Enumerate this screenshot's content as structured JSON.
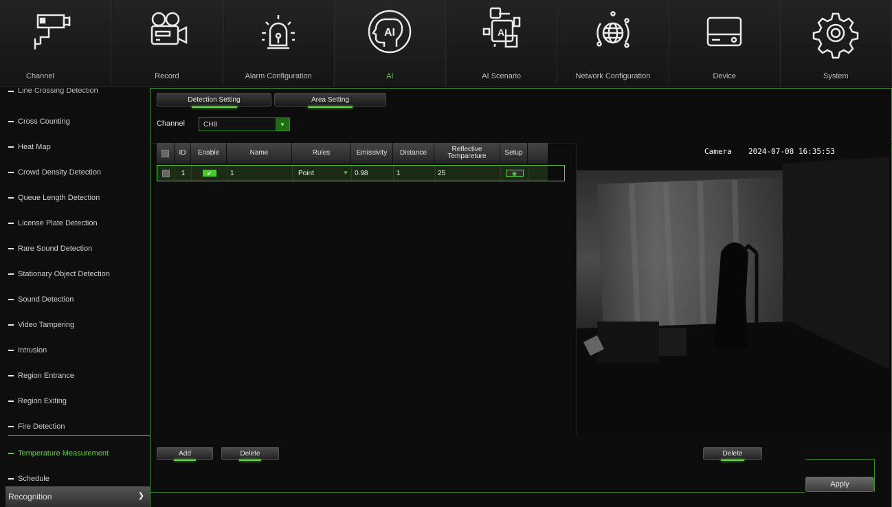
{
  "nav": {
    "items": [
      {
        "label": "Channel",
        "icon": "cctv-camera-icon"
      },
      {
        "label": "Record",
        "icon": "video-camera-icon"
      },
      {
        "label": "Alarm Configuration",
        "icon": "alarm-siren-icon"
      },
      {
        "label": "AI",
        "icon": "ai-head-icon",
        "active": true
      },
      {
        "label": "AI Scenario",
        "icon": "ai-scenario-icon"
      },
      {
        "label": "Network Configuration",
        "icon": "globe-network-icon"
      },
      {
        "label": "Device",
        "icon": "hard-drive-icon"
      },
      {
        "label": "System",
        "icon": "gear-icon"
      }
    ]
  },
  "sidebar": {
    "items": [
      {
        "label": "Line Crossing Detection"
      },
      {
        "label": "Cross Counting"
      },
      {
        "label": "Heat Map"
      },
      {
        "label": "Crowd Density Detection"
      },
      {
        "label": "Queue Length Detection"
      },
      {
        "label": "License Plate Detection"
      },
      {
        "label": "Rare Sound Detection"
      },
      {
        "label": "Stationary Object Detection"
      },
      {
        "label": "Sound Detection"
      },
      {
        "label": "Video Tampering"
      },
      {
        "label": "Intrusion"
      },
      {
        "label": "Region Entrance"
      },
      {
        "label": "Region Exiting"
      },
      {
        "label": "Fire Detection"
      },
      {
        "label": "Temperature Measurement",
        "active": true
      },
      {
        "label": "Schedule"
      }
    ],
    "recognition_label": "Recognition",
    "accent_color": "#5ed637"
  },
  "tabs": {
    "detection_setting": "Detection Setting",
    "area_setting": "Area Setting"
  },
  "channel": {
    "label": "Channel",
    "value": "CH8"
  },
  "table": {
    "headers": {
      "id": "ID",
      "enable": "Enable",
      "name": "Name",
      "rules": "Rules",
      "emissivity": "Emissivity",
      "distance": "Distance",
      "reflective_temperature": "Reflective Tempareture",
      "setup": "Setup"
    },
    "rows": [
      {
        "id": "1",
        "enabled": true,
        "name": "1",
        "rules": "Point",
        "emissivity": "0.98",
        "distance": "1",
        "reflective_temperature": "25"
      }
    ]
  },
  "preview": {
    "camera_label": "Camera",
    "timestamp": "2024-07-08 16:35:53"
  },
  "buttons": {
    "add": "Add",
    "delete": "Delete",
    "preview_delete": "Delete",
    "apply": "Apply"
  }
}
